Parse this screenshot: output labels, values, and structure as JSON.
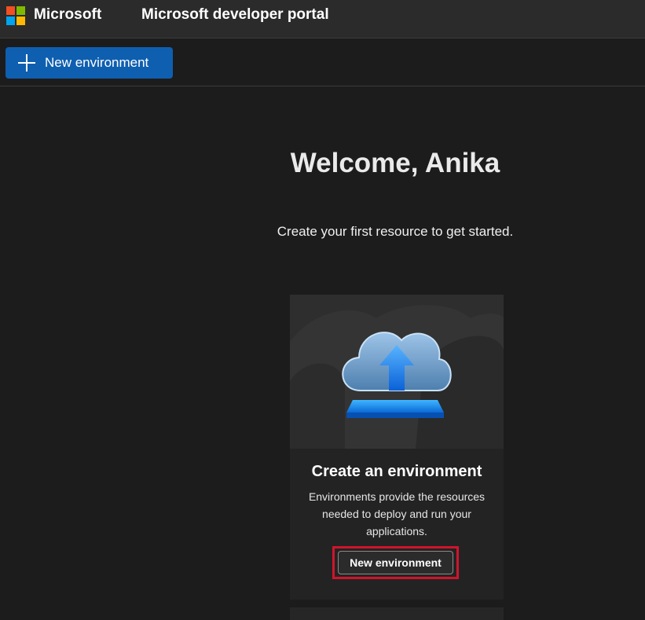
{
  "header": {
    "brand": "Microsoft",
    "title": "Microsoft developer portal",
    "logo_colors": [
      "#f25022",
      "#7fba00",
      "#00a4ef",
      "#ffb900"
    ]
  },
  "command_bar": {
    "new_environment_label": "New environment",
    "accent_color": "#0f5fb0"
  },
  "main": {
    "welcome": "Welcome, Anika",
    "subtitle": "Create your first resource to get started."
  },
  "card": {
    "illustration": "cloud-upload-icon",
    "title": "Create an environment",
    "description": "Environments provide the resources needed to deploy and run your applications.",
    "button_label": "New environment",
    "highlight_color": "#d0142c"
  }
}
